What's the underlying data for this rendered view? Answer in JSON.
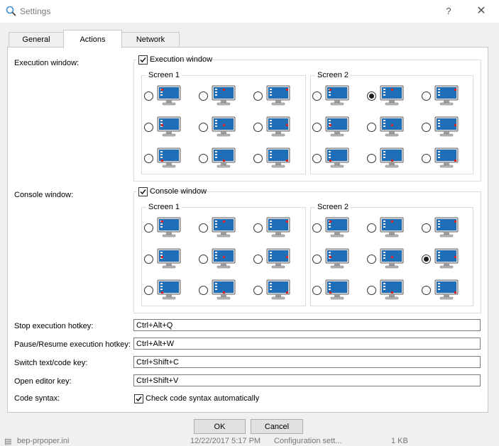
{
  "window": {
    "title": "Settings",
    "help": "?",
    "close": "✕"
  },
  "tabs": [
    {
      "label": "General",
      "active": false
    },
    {
      "label": "Actions",
      "active": true
    },
    {
      "label": "Network",
      "active": false
    }
  ],
  "execution": {
    "label": "Execution window:",
    "checkbox_label": "Execution window",
    "checked": true,
    "screen1": "Screen 1",
    "screen2": "Screen 2",
    "selected": {
      "screen": 2,
      "index": 1
    }
  },
  "console": {
    "label": "Console window:",
    "checkbox_label": "Console window",
    "checked": true,
    "screen1": "Screen 1",
    "screen2": "Screen 2",
    "selected": {
      "screen": 2,
      "index": 5
    }
  },
  "fields": [
    {
      "label": "Stop execution hotkey:",
      "value": "Ctrl+Alt+Q"
    },
    {
      "label": "Pause/Resume execution hotkey:",
      "value": "Ctrl+Alt+W"
    },
    {
      "label": "Switch text/code key:",
      "value": "Ctrl+Shift+C"
    },
    {
      "label": "Open editor key:",
      "value": "Ctrl+Shift+V"
    }
  ],
  "syntax": {
    "label": "Code syntax:",
    "checkbox_label": "Check code syntax automatically",
    "checked": true
  },
  "buttons": {
    "ok": "OK",
    "cancel": "Cancel"
  },
  "background_row": {
    "name": "bep-prpoper.ini",
    "date": "12/22/2017 5:17 PM",
    "type": "Configuration sett...",
    "size": "1 KB"
  },
  "colors": {
    "monitor_screen": "#1e6fb8",
    "dot": "#e02020",
    "accent": "#0078d7"
  }
}
